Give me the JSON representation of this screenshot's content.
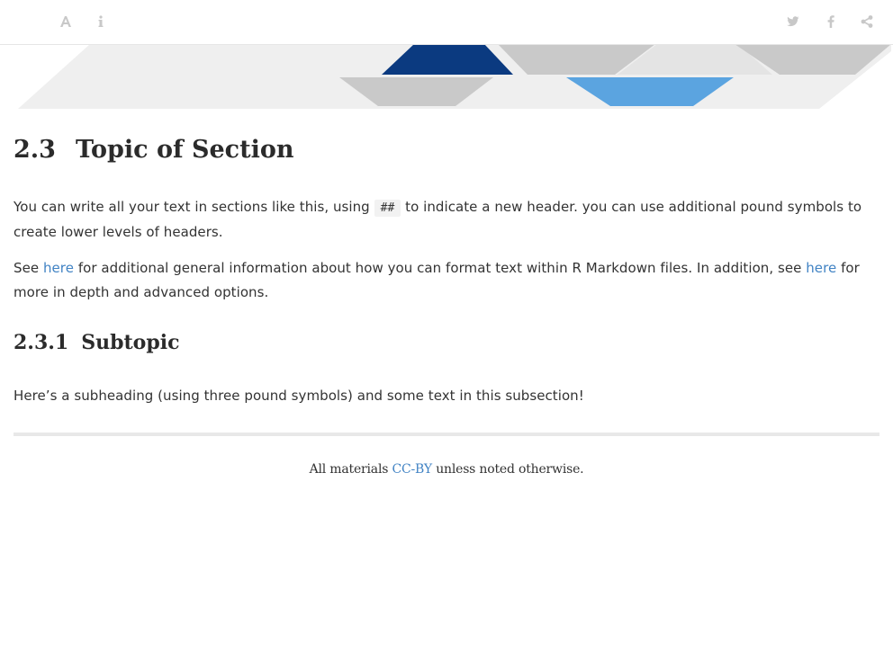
{
  "toolbar": {
    "left_icons": [
      "font-settings-icon",
      "info-icon"
    ],
    "right_icons": [
      "twitter-icon",
      "facebook-icon",
      "share-icon"
    ]
  },
  "section": {
    "number": "2.3",
    "title": "Topic of Section"
  },
  "paragraph1": {
    "before_code": "You can write all your text in sections like this, using",
    "code": "##",
    "after_code": "to indicate a new header. you can use additional pound symbols to create lower levels of headers."
  },
  "paragraph2": {
    "prefix": "See",
    "link1": "here",
    "middle": "for additional general information about how you can format text within R Markdown files. In addition, see",
    "link2": "here",
    "suffix": "for more in depth and advanced options."
  },
  "subsection": {
    "number": "2.3.1",
    "title": "Subtopic"
  },
  "paragraph3": {
    "text": "Here’s a subheading (using three pound symbols) and some text in this subsection!"
  },
  "footer": {
    "prefix": "All materials",
    "link": "CC-BY",
    "suffix": "unless noted otherwise."
  },
  "colors": {
    "link": "#4183c4",
    "banner_dark_blue": "#0b3a80",
    "banner_light_blue": "#5ba4e0",
    "banner_gray": "#c9c9c9",
    "banner_light_gray": "#efefef"
  }
}
